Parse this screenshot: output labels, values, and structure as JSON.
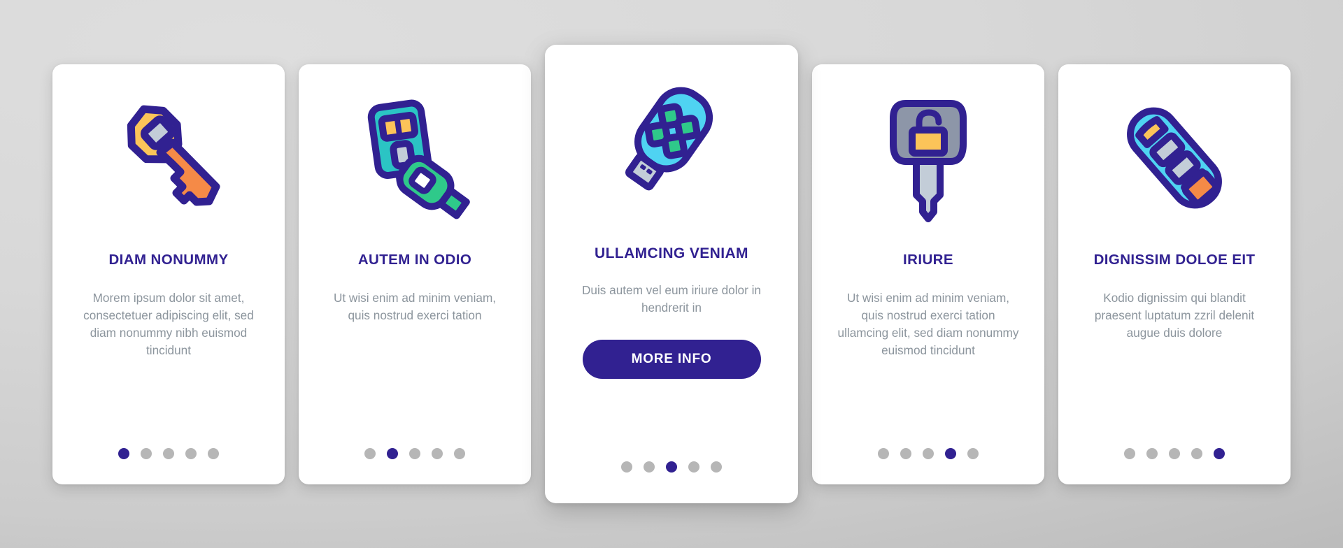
{
  "theme": {
    "background_top": "#dedede",
    "background_bottom": "#b9b9b9",
    "card_background": "#ffffff",
    "title_color": "#312191",
    "body_color": "#8c959d",
    "accent_color": "#312191",
    "dot_inactive_color": "#b6b6b6",
    "icon_outline": "#312191",
    "icon_yellow": "#fcc459",
    "icon_orange": "#f58a47",
    "icon_cyan": "#4fd3f2",
    "icon_teal": "#2bc4c4",
    "icon_green": "#2fc98a",
    "icon_green_dark": "#27a86f",
    "icon_gray": "#c3cdd8",
    "icon_gray_dark": "#8d96a8"
  },
  "cards": [
    {
      "icon": "classic-key-icon",
      "title": "DIAM NONUMMY",
      "body": "Morem ipsum dolor sit amet, consectetuer adipiscing elit, sed diam nonummy nibh euismod tincidunt",
      "dots_total": 5,
      "active_dot": 0,
      "featured": false,
      "button_label": null
    },
    {
      "icon": "car-key-fob-icon",
      "title": "AUTEM IN ODIO",
      "body": "Ut wisi enim ad minim veniam, quis nostrud exerci tation",
      "dots_total": 5,
      "active_dot": 1,
      "featured": false,
      "button_label": null
    },
    {
      "icon": "usb-remote-key-icon",
      "title": "ULLAMCING VENIAM",
      "body": "Duis autem vel eum iriure dolor in hendrerit in",
      "dots_total": 5,
      "active_dot": 2,
      "featured": true,
      "button_label": "MORE INFO"
    },
    {
      "icon": "padlock-key-icon",
      "title": "IRIURE",
      "body": "Ut wisi enim ad minim veniam, quis nostrud exerci tation ullamcing elit, sed diam nonummy euismod tincidunt",
      "dots_total": 5,
      "active_dot": 3,
      "featured": false,
      "button_label": null
    },
    {
      "icon": "car-remote-icon",
      "title": "DIGNISSIM DOLOE EIT",
      "body": "Kodio dignissim qui blandit praesent luptatum zzril delenit augue duis dolore",
      "dots_total": 5,
      "active_dot": 4,
      "featured": false,
      "button_label": null
    }
  ]
}
